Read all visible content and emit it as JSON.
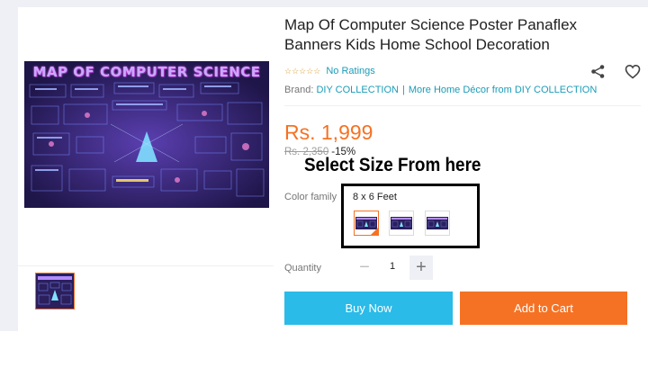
{
  "product": {
    "title": "Map Of Computer Science Poster Panaflex Banners Kids Home School Decoration",
    "image_text": "MAP OF COMPUTER SCIENCE",
    "rating_stars": "☆☆☆☆☆",
    "ratings_label": "No Ratings",
    "brand_label": "Brand:",
    "brand_name": "DIY COLLECTION",
    "brand_more": "More Home Décor from DIY COLLECTION",
    "price": "Rs. 1,999",
    "original_price": "Rs. 2,350",
    "discount": "-15%"
  },
  "variants": {
    "label": "Color family",
    "selected_value": "8 x 6 Feet",
    "options_count": 3
  },
  "quantity": {
    "label": "Quantity",
    "value": "1",
    "minus": "−",
    "plus": "+"
  },
  "actions": {
    "buy_now": "Buy Now",
    "add_to_cart": "Add to Cart"
  },
  "annotation": {
    "text": "Select Size From here"
  },
  "icons": {
    "share": "share-icon",
    "wishlist": "heart-icon"
  },
  "colors": {
    "accent_orange": "#f57224",
    "link_blue": "#1a9cb7",
    "buy_now_blue": "#2abbe8",
    "star_gold": "#d9a23a"
  }
}
